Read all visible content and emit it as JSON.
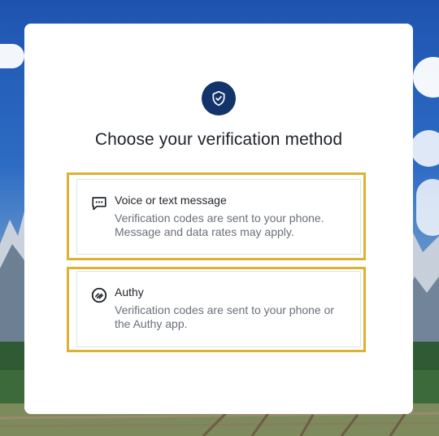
{
  "page": {
    "title": "Choose your verification method"
  },
  "options": [
    {
      "title": "Voice or text message",
      "description": "Verification codes are sent to your phone. Message and data rates may apply.",
      "icon": "message-icon"
    },
    {
      "title": "Authy",
      "description": "Verification codes are sent to your phone or the Authy app.",
      "icon": "authy-icon"
    }
  ],
  "header_icon": "shield-check-icon",
  "colors": {
    "badge": "#13346b",
    "highlight": "#dcb232",
    "title_text": "#1f2329",
    "description_text": "#6a7079",
    "card_border": "#dfe2e6"
  }
}
